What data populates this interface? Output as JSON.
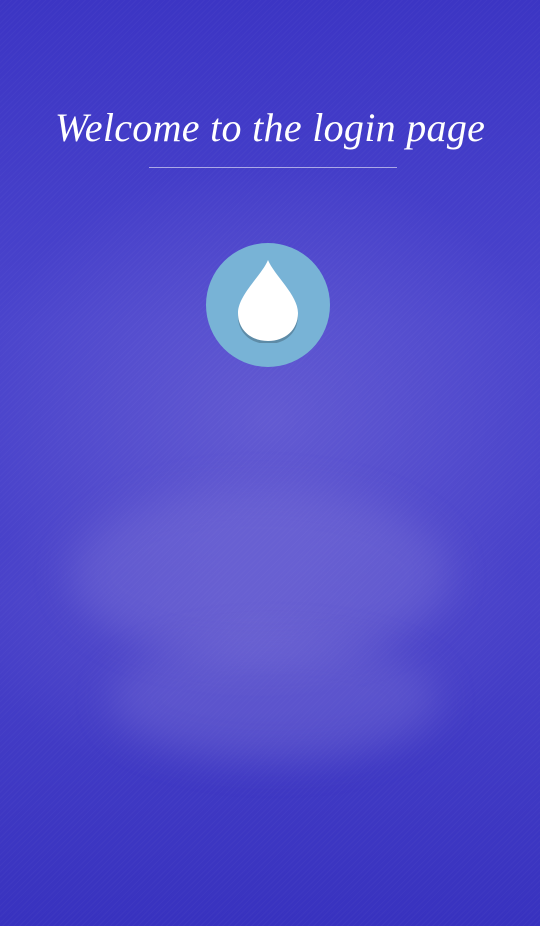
{
  "header": {
    "title": "Welcome to the login page"
  },
  "logo": {
    "icon": "water-drop-icon",
    "circle_color": "#78b3d6",
    "drop_color": "#ffffff"
  },
  "theme": {
    "background_color": "#4640c8",
    "text_color": "#ffffff"
  }
}
